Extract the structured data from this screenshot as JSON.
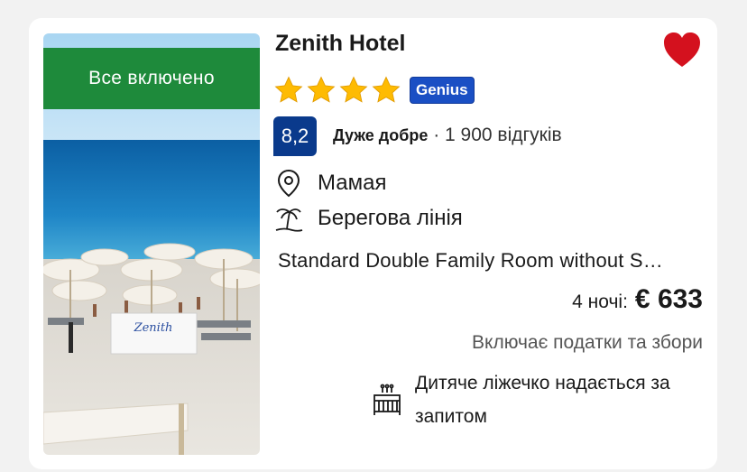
{
  "hotel": {
    "name": "Zenith Hotel",
    "badge": "Все включено",
    "stars": 4,
    "genius_label": "Genius",
    "score": "8,2",
    "score_word": "Дуже добре",
    "reviews": "1 900 відгуків",
    "location": "Мамая",
    "feature": "Берегова лінія",
    "room": "Standard Double Family Room without S…",
    "nights_label": "4 ночі:",
    "price": "€ 633",
    "taxes_note": "Включає податки та збори",
    "crib_note": "Дитяче ліжечко надається за запитом",
    "favorite": true
  },
  "colors": {
    "badge_green": "#1e8a3b",
    "genius_blue": "#1a4fc4",
    "score_blue": "#0a3a8c",
    "star_yellow": "#febb02",
    "heart_red": "#d4111e"
  },
  "icons": {
    "favorite": "heart-icon",
    "location": "map-pin-icon",
    "feature": "palm-beach-icon",
    "crib": "crib-icon",
    "star": "star-icon"
  }
}
